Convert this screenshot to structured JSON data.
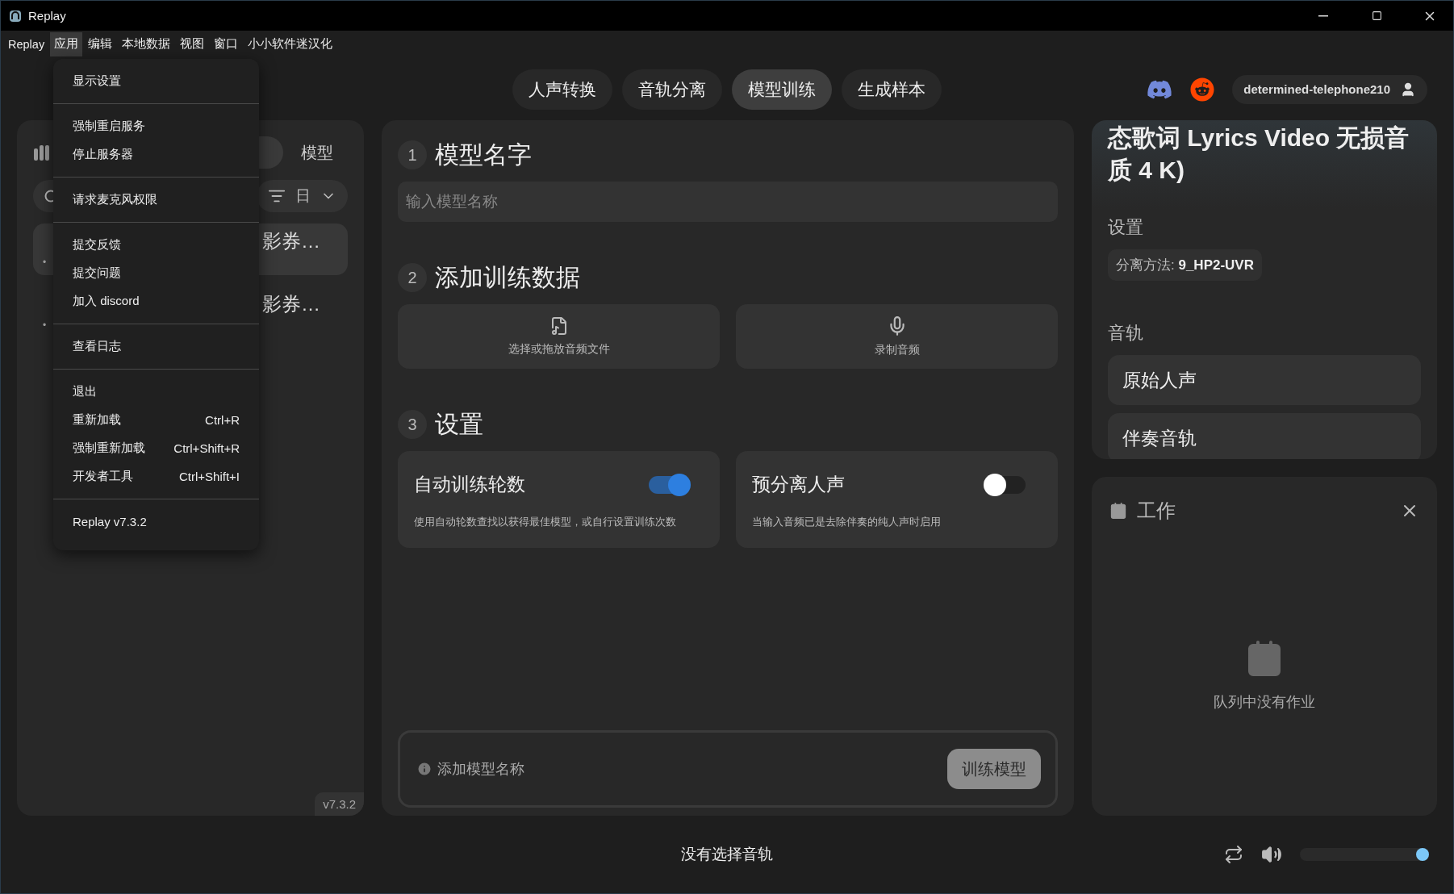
{
  "window": {
    "title": "Replay"
  },
  "menu_bar": [
    {
      "label": "Replay",
      "selected": false
    },
    {
      "label": "应用",
      "selected": true
    },
    {
      "label": "编辑",
      "selected": false
    },
    {
      "label": "本地数据",
      "selected": false
    },
    {
      "label": "视图",
      "selected": false
    },
    {
      "label": "窗口",
      "selected": false
    },
    {
      "label": "小小软件迷汉化",
      "selected": false
    }
  ],
  "app_menu": {
    "groups": [
      {
        "items": [
          {
            "label": "显示设置"
          }
        ]
      },
      {
        "items": [
          {
            "label": "强制重启服务"
          },
          {
            "label": "停止服务器"
          }
        ]
      },
      {
        "items": [
          {
            "label": "请求麦克风权限"
          }
        ]
      },
      {
        "items": [
          {
            "label": "提交反馈"
          },
          {
            "label": "提交问题"
          },
          {
            "label": "加入 discord"
          }
        ]
      },
      {
        "items": [
          {
            "label": "查看日志"
          }
        ]
      },
      {
        "items": [
          {
            "label": "退出"
          },
          {
            "label": "重新加载",
            "shortcut": "Ctrl+R"
          },
          {
            "label": "强制重新加载",
            "shortcut": "Ctrl+Shift+R"
          },
          {
            "label": "开发者工具",
            "shortcut": "Ctrl+Shift+I"
          }
        ]
      },
      {
        "items": [
          {
            "label": "Replay v7.3.2"
          }
        ]
      }
    ]
  },
  "mode_tabs": [
    {
      "label": "人声转换",
      "selected": false
    },
    {
      "label": "音轨分离",
      "selected": false
    },
    {
      "label": "模型训练",
      "selected": true
    },
    {
      "label": "生成样本",
      "selected": false
    }
  ],
  "header": {
    "username": "determined-telephone210"
  },
  "library": {
    "tabs": [
      {
        "label": "模型",
        "selected": false
      }
    ],
    "sort_label": "日",
    "items": [
      {
        "tail": "影券…",
        "meta": "•",
        "selected": true
      },
      {
        "tail": "影券…",
        "meta": "•",
        "selected": false
      }
    ],
    "version": "v7.3.2"
  },
  "training": {
    "steps": [
      {
        "number": "1",
        "title": "模型名字",
        "kind": "input",
        "placeholder": "输入模型名称"
      },
      {
        "number": "2",
        "title": "添加训练数据",
        "kind": "sources",
        "sources": [
          {
            "label": "选择或拖放音频文件",
            "kind": "file"
          },
          {
            "label": "录制音频",
            "kind": "mic"
          }
        ]
      },
      {
        "number": "3",
        "title": "设置",
        "kind": "settings",
        "settings": [
          {
            "title": "自动训练轮数",
            "description": "使用自动轮数查找以获得最佳模型，或自行设置训练次数",
            "on": true
          },
          {
            "title": "预分离人声",
            "description": "当输入音频已是去除伴奏的纯人声时启用",
            "on": false
          }
        ]
      }
    ],
    "footer": {
      "hint": "添加模型名称",
      "button": {
        "label": "训练模型",
        "disabled": true
      }
    }
  },
  "song": {
    "title": "态歌词 Lyrics Video 无损音质 4 K)",
    "settings_label": "设置",
    "setting_chip": "分离方法: **9_HP2-UVR**",
    "tracks_label": "音轨",
    "tracks": [
      "原始人声",
      "伴奏音轨"
    ]
  },
  "jobs": {
    "title": "工作",
    "empty": "队列中没有作业"
  },
  "player": {
    "status": "没有选择音轨",
    "volume": {
      "level": 1
    }
  }
}
